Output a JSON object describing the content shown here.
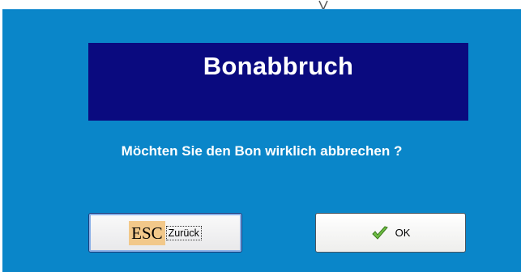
{
  "dialog": {
    "title": "Bonabbruch",
    "question": "Möchten Sie den Bon wirklich abbrechen ?",
    "colors": {
      "background": "#0a86c9",
      "title_box": "#0a0a7f",
      "text": "#ffffff",
      "esc_badge": "#f2c88a"
    }
  },
  "buttons": {
    "back": {
      "key": "ESC",
      "label": "Zurück"
    },
    "ok": {
      "icon": "checkmark-icon",
      "label": "OK"
    }
  }
}
